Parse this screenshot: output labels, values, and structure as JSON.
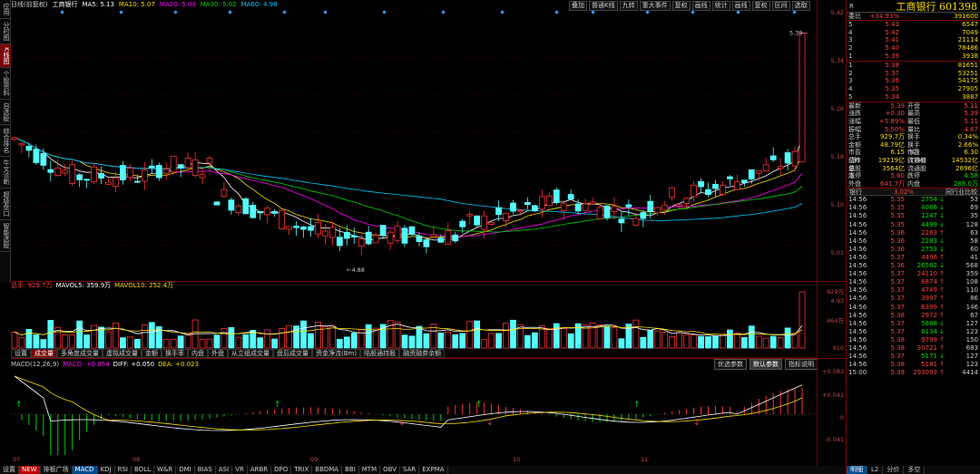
{
  "sidebar": [
    "应用",
    "分时图",
    "K线图",
    "个股资料",
    "自选股",
    "综合排名",
    "牛叉诊断",
    "超级盘口",
    "智能选股"
  ],
  "sidebar_active": 2,
  "topbar": {
    "period": "日线(前复权)",
    "stock": "工商银行",
    "ma5": "MA5: 5.13",
    "ma10": "MA10: 5.07",
    "ma20": "MA20: 5.03",
    "ma30": "MA30: 5.02",
    "ma60": "MA60: 4.98"
  },
  "toolbar": [
    "叠加",
    "普通K线",
    "九转",
    "重大事件",
    "复权",
    "画线",
    "统计",
    "画线",
    "复权",
    "区间",
    "选取"
  ],
  "price_axis": [
    "5.42",
    "5.34",
    "5.26",
    "5.18",
    "5.10",
    "5.01",
    "4.93"
  ],
  "high_label": "5.39",
  "low_label": "4.88",
  "volume": {
    "title": "总手: 929.7万",
    "mavol5": "MAVOL5: 359.9万",
    "mavol10": "MAVOL10: 252.4万",
    "axis": [
      "929万",
      "464万",
      "X10"
    ]
  },
  "indicator_tabs": [
    "设置",
    "成交量",
    "多角度成交量",
    "虚拟成交量",
    "金额",
    "换手率",
    "内盘",
    "外盘",
    "从立组成交量",
    "盘后成交量",
    "资金净流(Bm)",
    "陆股通持股",
    "融资融券余额"
  ],
  "indicator_active": 1,
  "macd": {
    "title": "MACD(12,26,9)",
    "macd": "MACD: +0.054",
    "diff": "DIFF: +0.050",
    "dea": "DEA: +0.023",
    "buttons": [
      "优选参数",
      "默认参数",
      "指标说明"
    ],
    "axis": [
      "+0.083",
      "+0.041",
      "0",
      "-0.041"
    ]
  },
  "dates": [
    "07",
    "08",
    "09",
    "10",
    "11"
  ],
  "bottom_tabs": [
    "设置",
    "NEW",
    "排板广场",
    "MACD",
    "KDJ",
    "RSI",
    "BOLL",
    "W&R",
    "DMI",
    "BIAS",
    "ASI",
    "VR",
    "ARBR",
    "DPO",
    "TRIX",
    "BBDMA",
    "BBI",
    "MTM",
    "OBV",
    "SAR",
    "EXPMA"
  ],
  "bottom_active": 3,
  "right": {
    "header_left": "R",
    "title": "工商银行 601398",
    "weibi_label": "委比",
    "weibi_pct": "+34.93%",
    "weibi_val": "391600",
    "sell": [
      {
        "n": "5",
        "p": "5.43",
        "v": "6547"
      },
      {
        "n": "4",
        "p": "5.42",
        "v": "7049"
      },
      {
        "n": "3",
        "p": "5.41",
        "v": "21114"
      },
      {
        "n": "2",
        "p": "5.40",
        "v": "78486"
      },
      {
        "n": "1",
        "p": "5.39",
        "v": "3938"
      }
    ],
    "buy": [
      {
        "n": "1",
        "p": "5.38",
        "v": "81651"
      },
      {
        "n": "2",
        "p": "5.37",
        "v": "53251"
      },
      {
        "n": "3",
        "p": "5.36",
        "v": "54175"
      },
      {
        "n": "4",
        "p": "5.35",
        "v": "27905"
      },
      {
        "n": "5",
        "p": "5.34",
        "v": "3887"
      }
    ],
    "stats": [
      {
        "k": "最新",
        "v": "5.39",
        "vc": "red",
        "k2": "开盘",
        "v2": "5.11",
        "v2c": "red"
      },
      {
        "k": "涨跌",
        "v": "+0.30",
        "vc": "red",
        "k2": "最高",
        "v2": "5.39",
        "v2c": "red"
      },
      {
        "k": "涨幅",
        "v": "+5.89%",
        "vc": "red",
        "k2": "最低",
        "v2": "5.11",
        "v2c": "red"
      },
      {
        "k": "振幅",
        "v": "5.50%",
        "vc": "red",
        "k2": "量比",
        "v2": "4.67",
        "v2c": "red"
      },
      {
        "k": "总手",
        "v": "929.7万",
        "vc": "yellow",
        "k2": "换手",
        "v2": "0.34%",
        "v2c": "yellow"
      },
      {
        "k": "金额",
        "v": "48.79亿",
        "vc": "yellow",
        "k2": "换手(实)",
        "v2": "2.66%",
        "v2c": "yellow"
      },
      {
        "k": "市盈(静)",
        "v": "6.15",
        "vc": "yellow",
        "k2": "市盈(TTM)",
        "v2": "6.30",
        "v2c": "yellow"
      },
      {
        "k": "总市值",
        "v": "19219亿",
        "vc": "yellow",
        "k2": "流通值",
        "v2": "14532亿",
        "v2c": "yellow"
      },
      {
        "k": "总股本",
        "v": "3564亿",
        "vc": "yellow",
        "k2": "流通股",
        "v2": "2696亿",
        "v2c": "yellow"
      },
      {
        "k": "涨停",
        "v": "5.60",
        "vc": "red",
        "k2": "跌停",
        "v2": "4.58",
        "v2c": "green"
      },
      {
        "k": "外盘",
        "v": "641.7万",
        "vc": "red",
        "k2": "内盘",
        "v2": "288.0万",
        "v2c": "green"
      }
    ],
    "tick_head_left": "银行",
    "tick_head_mid": "3.02%",
    "tick_head_right": "同行业比较",
    "ticks": [
      {
        "t": "14:56",
        "p": "5.35",
        "v": "2754",
        "d": "dn",
        "n": "53"
      },
      {
        "t": "14:56",
        "p": "5.35",
        "v": "4086",
        "d": "dn",
        "n": "69"
      },
      {
        "t": "14:56",
        "p": "5.35",
        "v": "1247",
        "d": "dn",
        "n": "35"
      },
      {
        "t": "14:56",
        "p": "5.35",
        "v": "4499",
        "d": "dn",
        "n": "128"
      },
      {
        "t": "14:56",
        "p": "5.36",
        "v": "2263",
        "d": "up",
        "n": "63"
      },
      {
        "t": "14:56",
        "p": "5.36",
        "v": "2283",
        "d": "dn",
        "n": "58"
      },
      {
        "t": "14:56",
        "p": "5.36",
        "v": "2753",
        "d": "dn",
        "n": "60"
      },
      {
        "t": "14:56",
        "p": "5.37",
        "v": "4496",
        "d": "up",
        "n": "41"
      },
      {
        "t": "14:56",
        "p": "5.36",
        "v": "26562",
        "d": "dn",
        "n": "568"
      },
      {
        "t": "14:56",
        "p": "5.37",
        "v": "24110",
        "d": "up",
        "n": "359"
      },
      {
        "t": "14:56",
        "p": "5.37",
        "v": "6874",
        "d": "up",
        "n": "108"
      },
      {
        "t": "14:56",
        "p": "5.37",
        "v": "4749",
        "d": "up",
        "n": "110"
      },
      {
        "t": "14:56",
        "p": "5.37",
        "v": "3997",
        "d": "up",
        "n": "86"
      },
      {
        "t": "14:56",
        "p": "5.37",
        "v": "6399",
        "d": "up",
        "n": "146"
      },
      {
        "t": "14:56",
        "p": "5.38",
        "v": "2972",
        "d": "up",
        "n": "67"
      },
      {
        "t": "14:56",
        "p": "5.37",
        "v": "5888",
        "d": "dn",
        "n": "127"
      },
      {
        "t": "14:56",
        "p": "5.37",
        "v": "6134",
        "d": "dn",
        "n": "123"
      },
      {
        "t": "14:56",
        "p": "5.38",
        "v": "9799",
        "d": "up",
        "n": "150"
      },
      {
        "t": "14:56",
        "p": "5.38",
        "v": "30721",
        "d": "up",
        "n": "683"
      },
      {
        "t": "14:56",
        "p": "5.37",
        "v": "5171",
        "d": "dn",
        "n": "127"
      },
      {
        "t": "14:56",
        "p": "5.38",
        "v": "5181",
        "d": "up",
        "n": "123"
      },
      {
        "t": "15:00",
        "p": "5.39",
        "v": "293093",
        "d": "up",
        "n": "4414"
      }
    ],
    "bottom_tabs": [
      "明细",
      "L2",
      "分价",
      "多空"
    ],
    "bottom_active": 0
  },
  "colors": {
    "up": "#ff3030",
    "down": "#54ffff",
    "ma5": "#ffffff",
    "ma10": "#ffde00",
    "ma20": "#ff00ff",
    "ma30": "#00d000",
    "ma60": "#00c8ff"
  }
}
